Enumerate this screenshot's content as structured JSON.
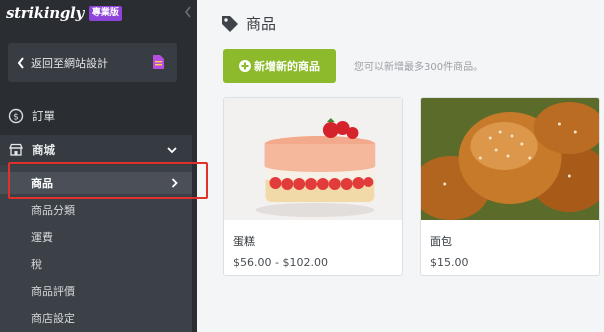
{
  "brand": {
    "logo": "strikingly",
    "badge": "專業版"
  },
  "sidebar": {
    "back_label": "返回至網站設計",
    "orders_label": "訂單",
    "store_label": "商城",
    "items": [
      {
        "label": "商品",
        "active": true
      },
      {
        "label": "商品分類"
      },
      {
        "label": "運費"
      },
      {
        "label": "稅"
      },
      {
        "label": "商品評價"
      },
      {
        "label": "商店設定"
      }
    ]
  },
  "main": {
    "title": "商品",
    "add_button_label": "新增新的商品",
    "hint": "您可以新增最多300件商品。",
    "products": [
      {
        "name": "蛋糕",
        "price": "$56.00 - $102.00"
      },
      {
        "name": "面包",
        "price": "$15.00"
      }
    ]
  },
  "colors": {
    "sidebar_bg": "#2a2e33",
    "accent_green": "#8cba2c",
    "badge_purple": "#8e44d8",
    "highlight_red": "#e0312b"
  },
  "icons": [
    "chevron-left-icon",
    "document-icon",
    "dollar-circle-icon",
    "store-icon",
    "chevron-down-icon",
    "chevron-right-icon",
    "tag-icon",
    "plus-circle-icon"
  ]
}
